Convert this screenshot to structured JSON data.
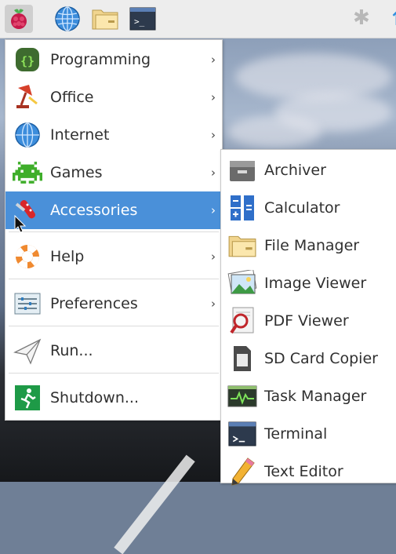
{
  "panel": {
    "launcher_icon": "raspberry-icon",
    "browser_icon": "globe-icon",
    "file_manager_icon": "folder-icon",
    "terminal_icon": "terminal-icon",
    "terminal_glyph": ">_",
    "bluetooth_icon": "bluetooth-icon",
    "bluetooth_glyph": "✱"
  },
  "menu": {
    "items": [
      {
        "label": "Programming",
        "icon": "programming-icon",
        "has_submenu": true,
        "arrow": "›"
      },
      {
        "label": "Office",
        "icon": "office-lamp-icon",
        "has_submenu": true,
        "arrow": "›"
      },
      {
        "label": "Internet",
        "icon": "globe-icon",
        "has_submenu": true,
        "arrow": "›"
      },
      {
        "label": "Games",
        "icon": "space-invader-icon",
        "has_submenu": true,
        "arrow": "›"
      },
      {
        "label": "Accessories",
        "icon": "pocket-knife-icon",
        "has_submenu": true,
        "arrow": "›",
        "active": true
      },
      {
        "label": "Help",
        "icon": "lifebuoy-icon",
        "has_submenu": true,
        "arrow": "›"
      },
      {
        "label": "Preferences",
        "icon": "preferences-icon",
        "has_submenu": true,
        "arrow": "›"
      },
      {
        "label": "Run...",
        "icon": "paper-plane-icon",
        "has_submenu": false
      },
      {
        "label": "Shutdown...",
        "icon": "exit-icon",
        "has_submenu": false
      }
    ]
  },
  "submenu": {
    "items": [
      {
        "label": "Archiver",
        "icon": "archiver-icon"
      },
      {
        "label": "Calculator",
        "icon": "calculator-icon"
      },
      {
        "label": "File Manager",
        "icon": "folder-icon"
      },
      {
        "label": "Image Viewer",
        "icon": "image-viewer-icon"
      },
      {
        "label": "PDF Viewer",
        "icon": "pdf-viewer-icon"
      },
      {
        "label": "SD Card Copier",
        "icon": "sd-card-icon"
      },
      {
        "label": "Task Manager",
        "icon": "task-manager-icon"
      },
      {
        "label": "Terminal",
        "icon": "terminal-icon"
      },
      {
        "label": "Text Editor",
        "icon": "pencil-icon"
      }
    ]
  },
  "colors": {
    "highlight": "#4a90d9",
    "panel": "#ededed",
    "menu_bg": "#ffffff"
  }
}
